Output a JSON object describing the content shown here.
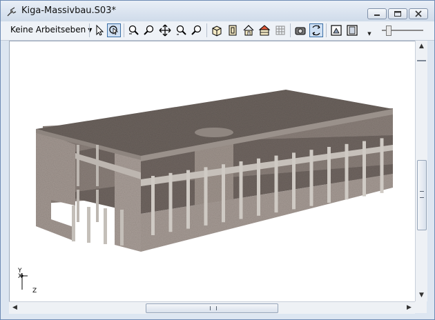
{
  "window": {
    "title": "Kiga-Massivbau.S03*"
  },
  "window_controls": {
    "minimize": "minimize",
    "maximize": "maximize",
    "close": "close"
  },
  "toolbar": {
    "layer_dropdown": "Keine Arbeitseben",
    "tools": [
      {
        "name": "select-arrow-icon"
      },
      {
        "name": "select-region-icon",
        "active": true
      },
      {
        "name": "zoom-window-icon"
      },
      {
        "name": "zoom-out-icon"
      },
      {
        "name": "pan-icon"
      },
      {
        "name": "zoom-in-icon"
      },
      {
        "name": "zoom-previous-icon"
      },
      {
        "name": "view-3d-icon"
      },
      {
        "name": "view-front-icon"
      },
      {
        "name": "view-house-icon"
      },
      {
        "name": "view-house-section-icon"
      },
      {
        "name": "grid-icon"
      },
      {
        "name": "render-icon"
      },
      {
        "name": "rotate-view-icon",
        "active": true
      },
      {
        "name": "view-window-icon"
      },
      {
        "name": "view-frame-icon"
      }
    ]
  },
  "axis_indicator": {
    "y": "Y",
    "x": "X",
    "z": "Z"
  },
  "colors": {
    "concrete": "#9a8d86",
    "slab": "#6b625d",
    "column": "#c9c4be",
    "accent": "#3a6ea5"
  }
}
